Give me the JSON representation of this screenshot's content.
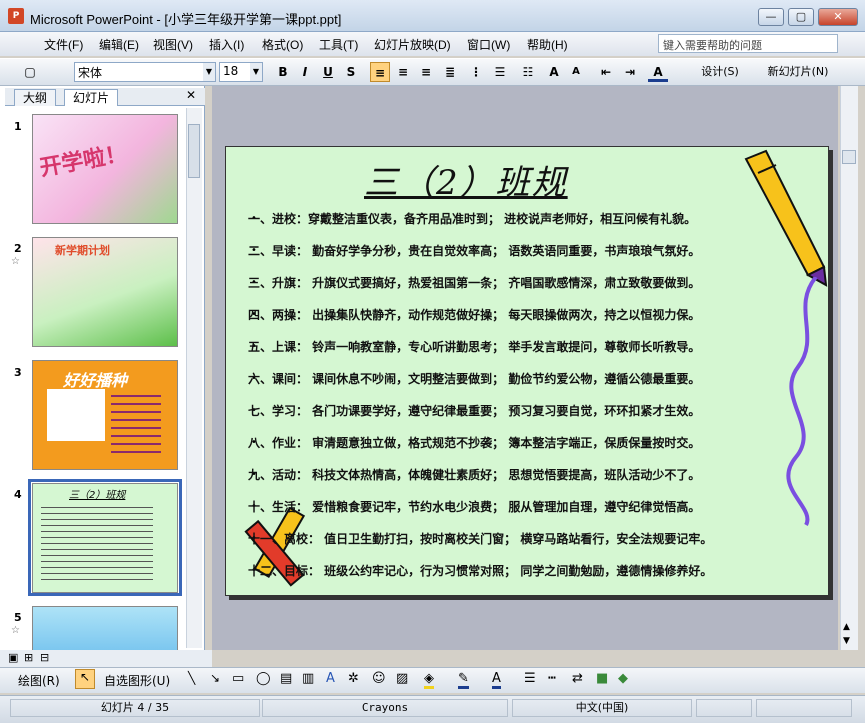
{
  "window": {
    "title": "Microsoft PowerPoint - [小学三年级开学第一课ppt.ppt]",
    "min": "—",
    "max": "▢",
    "close": "✕"
  },
  "menu": [
    "文件(F)",
    "编辑(E)",
    "视图(V)",
    "插入(I)",
    "格式(O)",
    "工具(T)",
    "幻灯片放映(D)",
    "窗口(W)",
    "帮助(H)"
  ],
  "help_placeholder": "键入需要帮助的问题",
  "toolbar": {
    "font": "宋体",
    "size": "18",
    "bold": "B",
    "italic": "I",
    "underline": "U",
    "shadow": "S",
    "design": "设计(S)",
    "new_slide": "新幻灯片(N)"
  },
  "tabs": {
    "outline": "大纲",
    "slides": "幻灯片",
    "close": "✕"
  },
  "thumbs": [
    {
      "num": "1",
      "text": "开学啦！",
      "bg": "#f6d6ef"
    },
    {
      "num": "2",
      "text": "新学期计划",
      "bg": "#c9f0c0"
    },
    {
      "num": "3",
      "text": "好好播种",
      "bg": "#f39b1e"
    },
    {
      "num": "4",
      "text": "三（2）班规",
      "bg": "#d5f7d2"
    },
    {
      "num": "5",
      "text": "",
      "bg": "#aee3f7"
    }
  ],
  "slide": {
    "title": "三（2）班规",
    "rules": [
      "一、进校：穿戴整洁重仪表，备齐用品准时到；  进校说声老师好，相互问候有礼貌。",
      "二、早读：  勤奋好学争分秒，贵在自觉效率高；  语数英语同重要，书声琅琅气氛好。",
      "三、升旗：  升旗仪式要搞好，热爱祖国第一条；  齐唱国歌感情深，肃立致敬要做到。",
      " 四、两操：  出操集队快静齐，动作规范做好操；  每天眼操做两次，持之以恒视力保。",
      " 五、上课：  铃声一响教室静，专心听讲勤思考；  举手发言敢提问，尊敬师长听教导。",
      " 六、课间：  课间休息不吵闹，文明整洁要做到；  勤俭节约爱公物，遵循公德最重要。",
      "七、学习：  各门功课要学好，遵守纪律最重要；  预习复习要自觉，环环扣紧才生效。",
      "八、作业：  审清题意独立做，格式规范不抄袭；  簿本整洁字端正，保质保量按时交。",
      "九、活动：  科技文体热情高，体魄健壮素质好；  思想觉悟要提高，班队活动少不了。",
      "  十、生活：  爱惜粮食要记牢，节约水电少浪费；  服从管理加自理，遵守纪律觉悟高。",
      "  十一、离校：  值日卫生勤打扫，按时离校关门窗；  横穿马路站看行，安全法规要记牢。",
      "  十二、目标：  班级公约牢记心，行为习惯常对照；  同学之间勤勉励，遵德情操修养好。"
    ]
  },
  "drawbar": {
    "draw": "绘图(R)",
    "autoshape": "自选图形(U)"
  },
  "status": {
    "slide": "幻灯片 4 / 35",
    "template": "Crayons",
    "lang": "中文(中国)"
  }
}
